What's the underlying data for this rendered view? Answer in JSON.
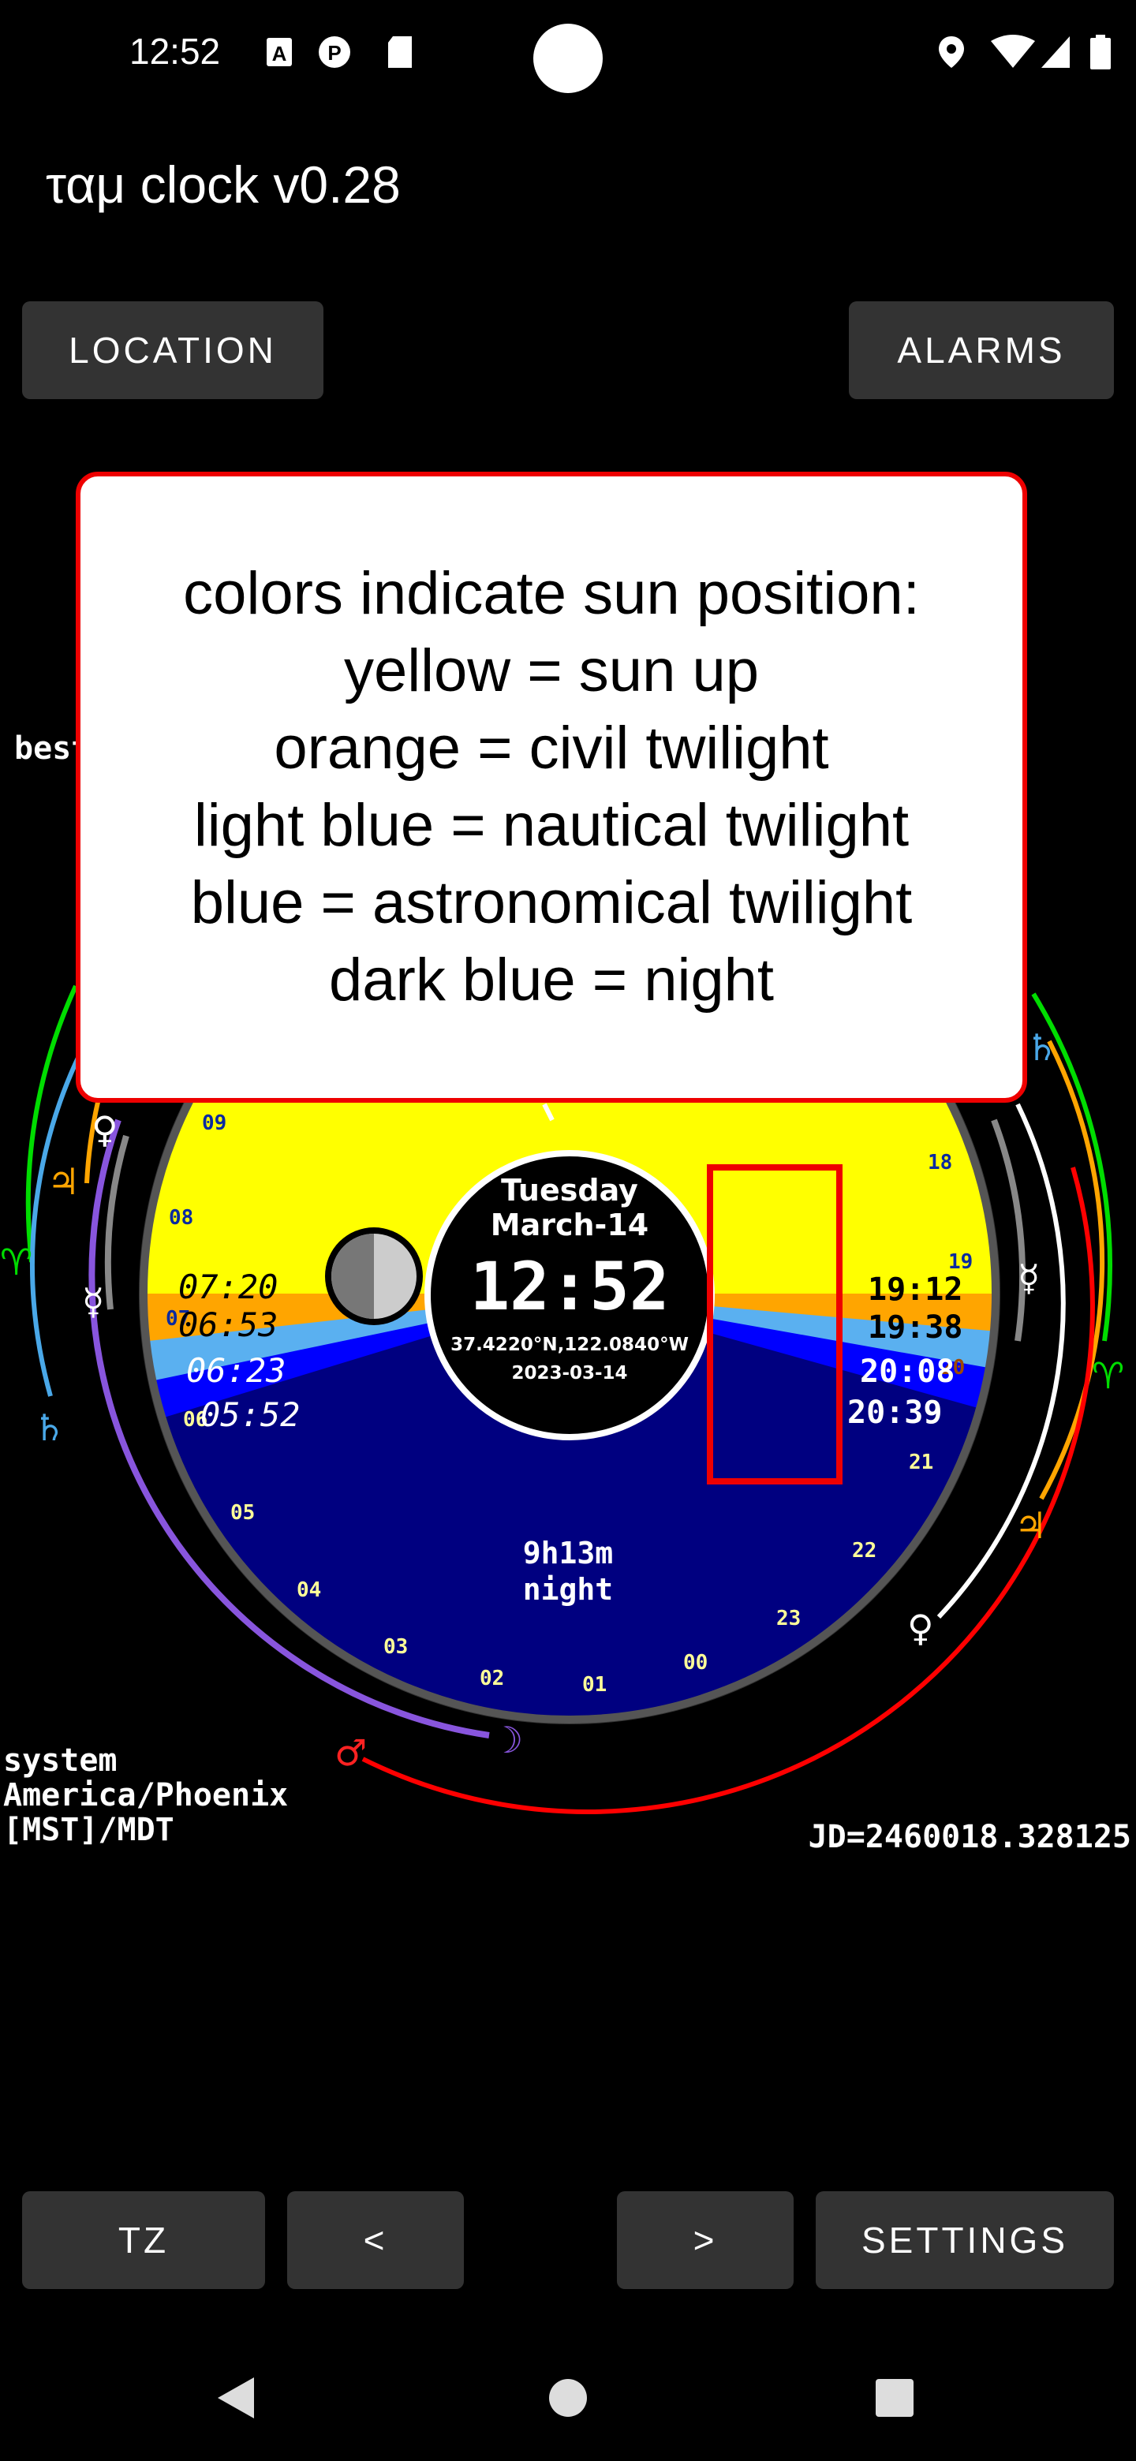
{
  "status": {
    "time": "12:52",
    "icons": [
      "notification-a-icon",
      "app-p-icon",
      "sd-card-icon",
      "location-icon",
      "wifi-icon",
      "signal-icon",
      "battery-icon"
    ]
  },
  "app": {
    "title": "ταμ clock v0.28"
  },
  "top_buttons": {
    "location": "LOCATION",
    "alarms": "ALARMS"
  },
  "side_label": "best",
  "tooltip": {
    "lines": [
      "colors indicate sun position:",
      "yellow = sun up",
      "orange = civil twilight",
      "light blue = nautical twilight",
      "blue = astronomical twilight",
      "dark blue = night"
    ]
  },
  "clock": {
    "weekday": "Tuesday",
    "month_day": "March-14",
    "time": "12:52",
    "coords": "37.4220°N,122.0840°W",
    "date": "2023-03-14",
    "night_duration": "9h13m",
    "night_label": "night",
    "morning_times": [
      "07:20",
      "06:53",
      "06:23",
      "05:52"
    ],
    "evening_times": [
      "19:12",
      "19:38",
      "20:08",
      "20:39"
    ],
    "hours": [
      "00",
      "01",
      "02",
      "03",
      "04",
      "05",
      "06",
      "07",
      "08",
      "09",
      "18",
      "19",
      "20",
      "21",
      "22",
      "23"
    ],
    "colors": {
      "day": "#ffff00",
      "civil": "#ffa500",
      "nautical": "#5ab0f0",
      "astronomical": "#0000ff",
      "night": "#000080"
    }
  },
  "timezone": {
    "line1": "system",
    "line2": "America/Phoenix",
    "line3": "[MST]/MDT"
  },
  "julian_date": "JD=2460018.328125",
  "bottom_buttons": {
    "tz": "TZ",
    "prev": "<",
    "next": ">",
    "settings": "SETTINGS"
  }
}
